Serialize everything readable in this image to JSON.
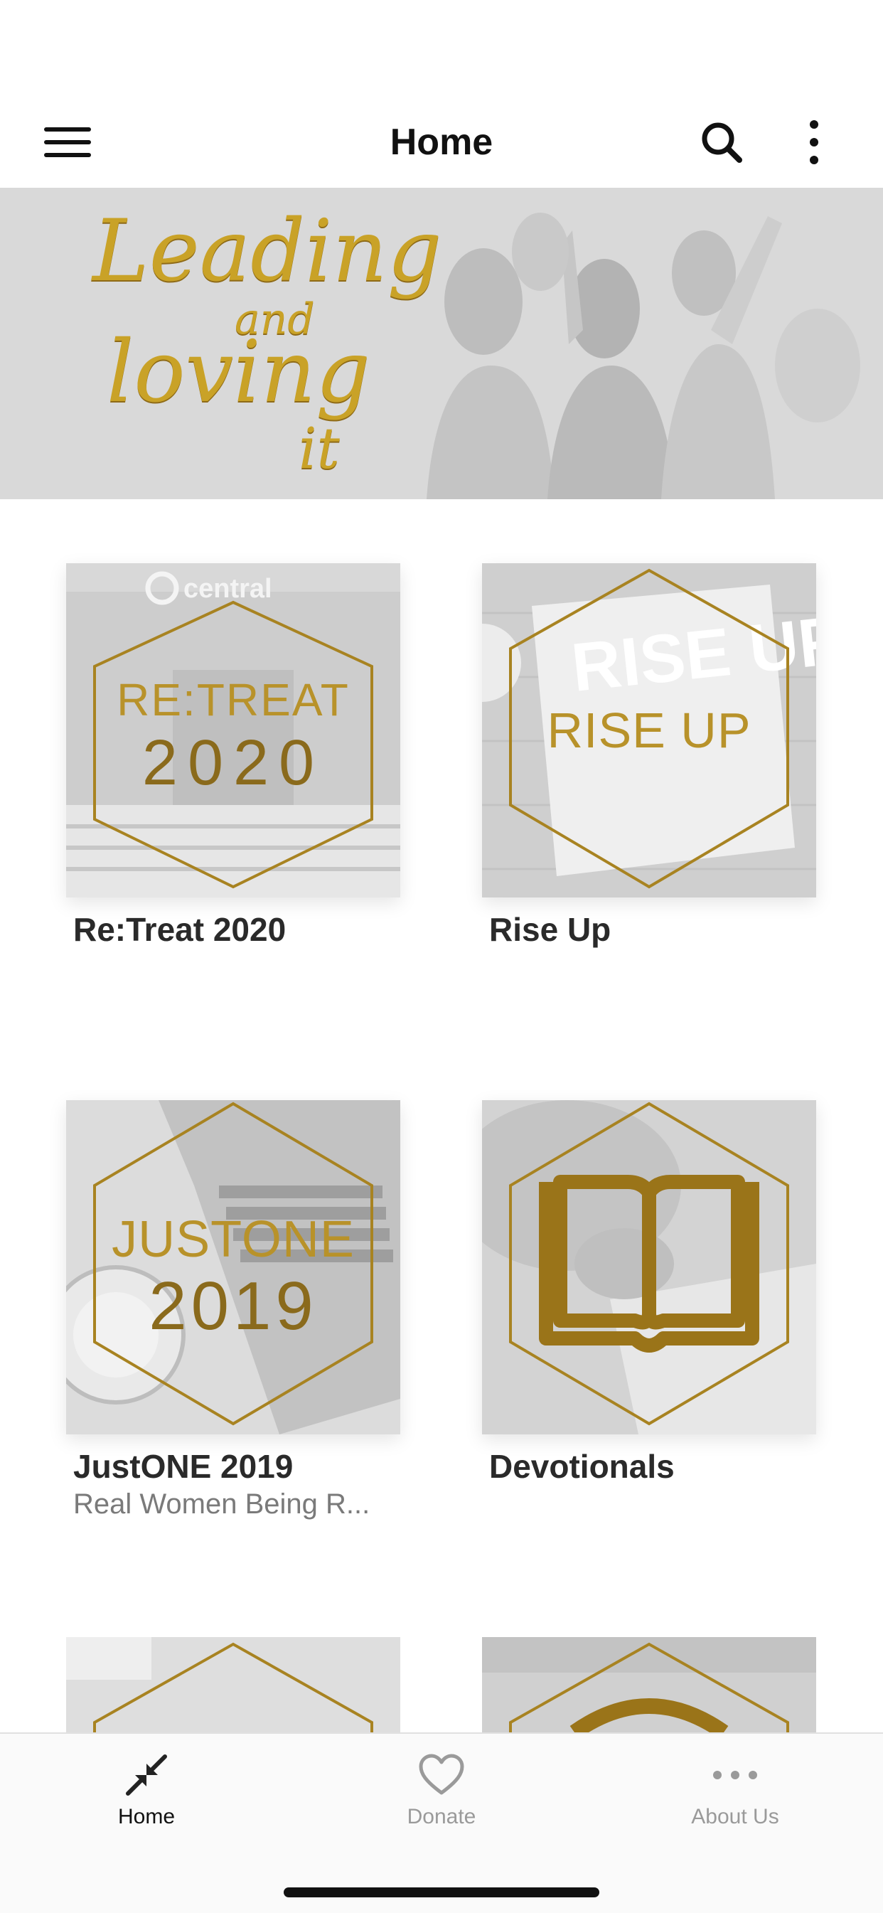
{
  "nav": {
    "title": "Home",
    "menu_icon": "hamburger-menu-icon",
    "search_icon": "search-icon",
    "more_icon": "vertical-ellipsis-icon"
  },
  "hero": {
    "script_lines": [
      "Leading",
      "and",
      "loving",
      "it"
    ],
    "gold": "#c9a227"
  },
  "cards": [
    {
      "title": "Re:Treat 2020",
      "subtitle": "",
      "tile_text": [
        "RE:TREAT",
        "2020"
      ],
      "tile_brand": "central"
    },
    {
      "title": "Rise Up",
      "subtitle": "",
      "tile_text": [
        "RISE UP"
      ],
      "tile_brand": "RISE UP"
    },
    {
      "title": "JustONE 2019",
      "subtitle": "Real Women Being R...",
      "tile_text": [
        "JUSTONE",
        "2019"
      ]
    },
    {
      "title": "Devotionals",
      "subtitle": "",
      "tile_icon": "open-book-icon"
    }
  ],
  "tabs": [
    {
      "label": "Home",
      "icon": "collapse-arrows-icon",
      "active": true
    },
    {
      "label": "Donate",
      "icon": "heart-icon",
      "active": false
    },
    {
      "label": "About Us",
      "icon": "horizontal-ellipsis-icon",
      "active": false
    }
  ],
  "colors": {
    "gold": "#b8922a",
    "gold_dark": "#7a5a14",
    "tab_active": "#111111",
    "tab_inactive": "#9a9a9a"
  }
}
